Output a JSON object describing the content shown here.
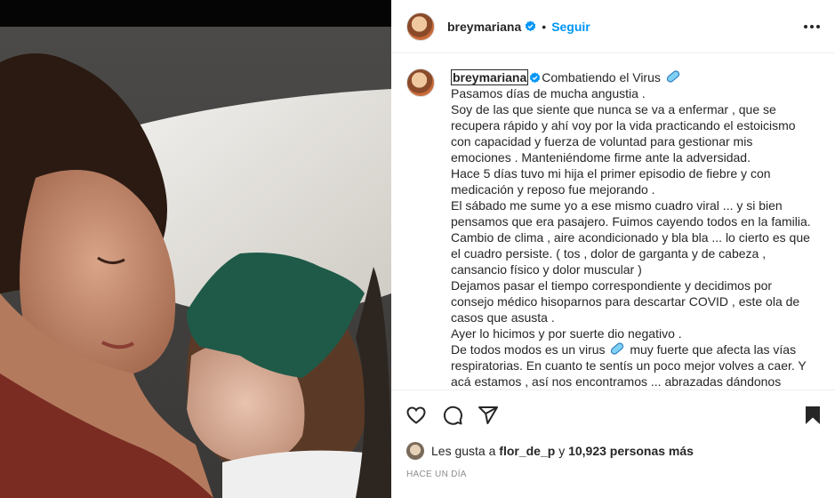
{
  "post": {
    "username": "breymariana",
    "separator": "•",
    "follow_label": "Seguir"
  },
  "caption": {
    "username": "breymariana",
    "lines": [
      "Combatiendo el Virus",
      "Pasamos días de mucha angustia .",
      "Soy de las que siente que nunca se va a enfermar , que se",
      "recupera rápido y ahí voy por la vida practicando el estoicismo",
      "con capacidad y fuerza de voluntad para gestionar mis",
      "emociones . Manteniéndome firme ante la adversidad.",
      "Hace 5 días tuvo mi hija el primer episodio de fiebre y con",
      "medicación y reposo fue mejorando .",
      "El sábado me sume yo a ese mismo cuadro viral ... y si bien",
      "pensamos que era pasajero. Fuimos cayendo todos en la familia.",
      "Cambio de clima , aire acondicionado y bla bla ... lo cierto es que",
      "el cuadro persiste. ( tos , dolor de garganta y de cabeza ,",
      "cansancio físico y dolor muscular )",
      "Dejamos pasar el tiempo correspondiente y decidimos por",
      "consejo médico hisoparnos para descartar COVID , este ola de",
      "casos que asusta .",
      "Ayer lo hicimos y por suerte dio negativo .",
      "De todos modos es un virus",
      "muy fuerte que afecta las vías",
      "respiratorias. En cuanto te sentís un poco mejor volves a caer. Y",
      "acá estamos , así nos encontramos ... abrazadas dándonos"
    ]
  },
  "likes": {
    "prefix": "Les gusta a",
    "user": "flor_de_p",
    "connector": "y",
    "count": "10,923 personas más"
  },
  "time_label": "HACE UN DÍA",
  "icons": [
    "heart-icon",
    "comment-icon",
    "share-icon",
    "bookmark-icon",
    "more-options-icon",
    "verified-badge-icon",
    "pill-emoji"
  ],
  "colors": {
    "accent": "#0095f6",
    "verified": "#0095f6",
    "text": "#262626",
    "muted": "#8e8e8e"
  }
}
